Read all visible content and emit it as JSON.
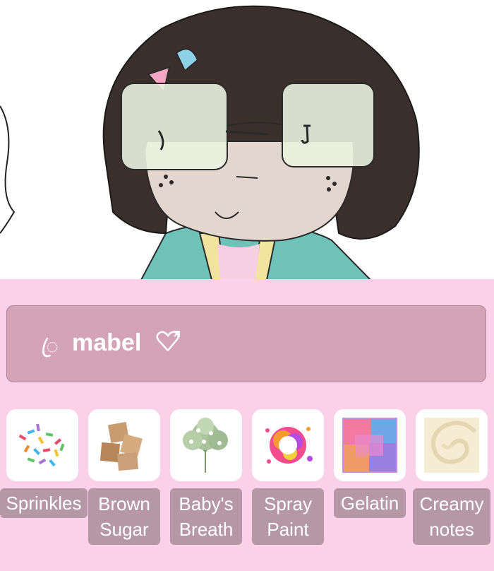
{
  "profile": {
    "name": "mabel",
    "name_prefix": "ꦿ"
  },
  "stickers": [
    {
      "label": "Sprinkles",
      "icon": "sprinkles-icon"
    },
    {
      "label": "Brown\nSugar",
      "icon": "brown-sugar-icon"
    },
    {
      "label": "Baby's\nBreath",
      "icon": "babys-breath-icon"
    },
    {
      "label": "Spray\nPaint",
      "icon": "spray-paint-icon"
    },
    {
      "label": "Gelatin",
      "icon": "gelatin-icon"
    },
    {
      "label": "Creamy\nnotes",
      "icon": "creamy-notes-icon"
    }
  ],
  "colors": {
    "panel": "#fbd0e8",
    "name_bar": "#d4a3b5",
    "label_bg": "#b697a5"
  }
}
